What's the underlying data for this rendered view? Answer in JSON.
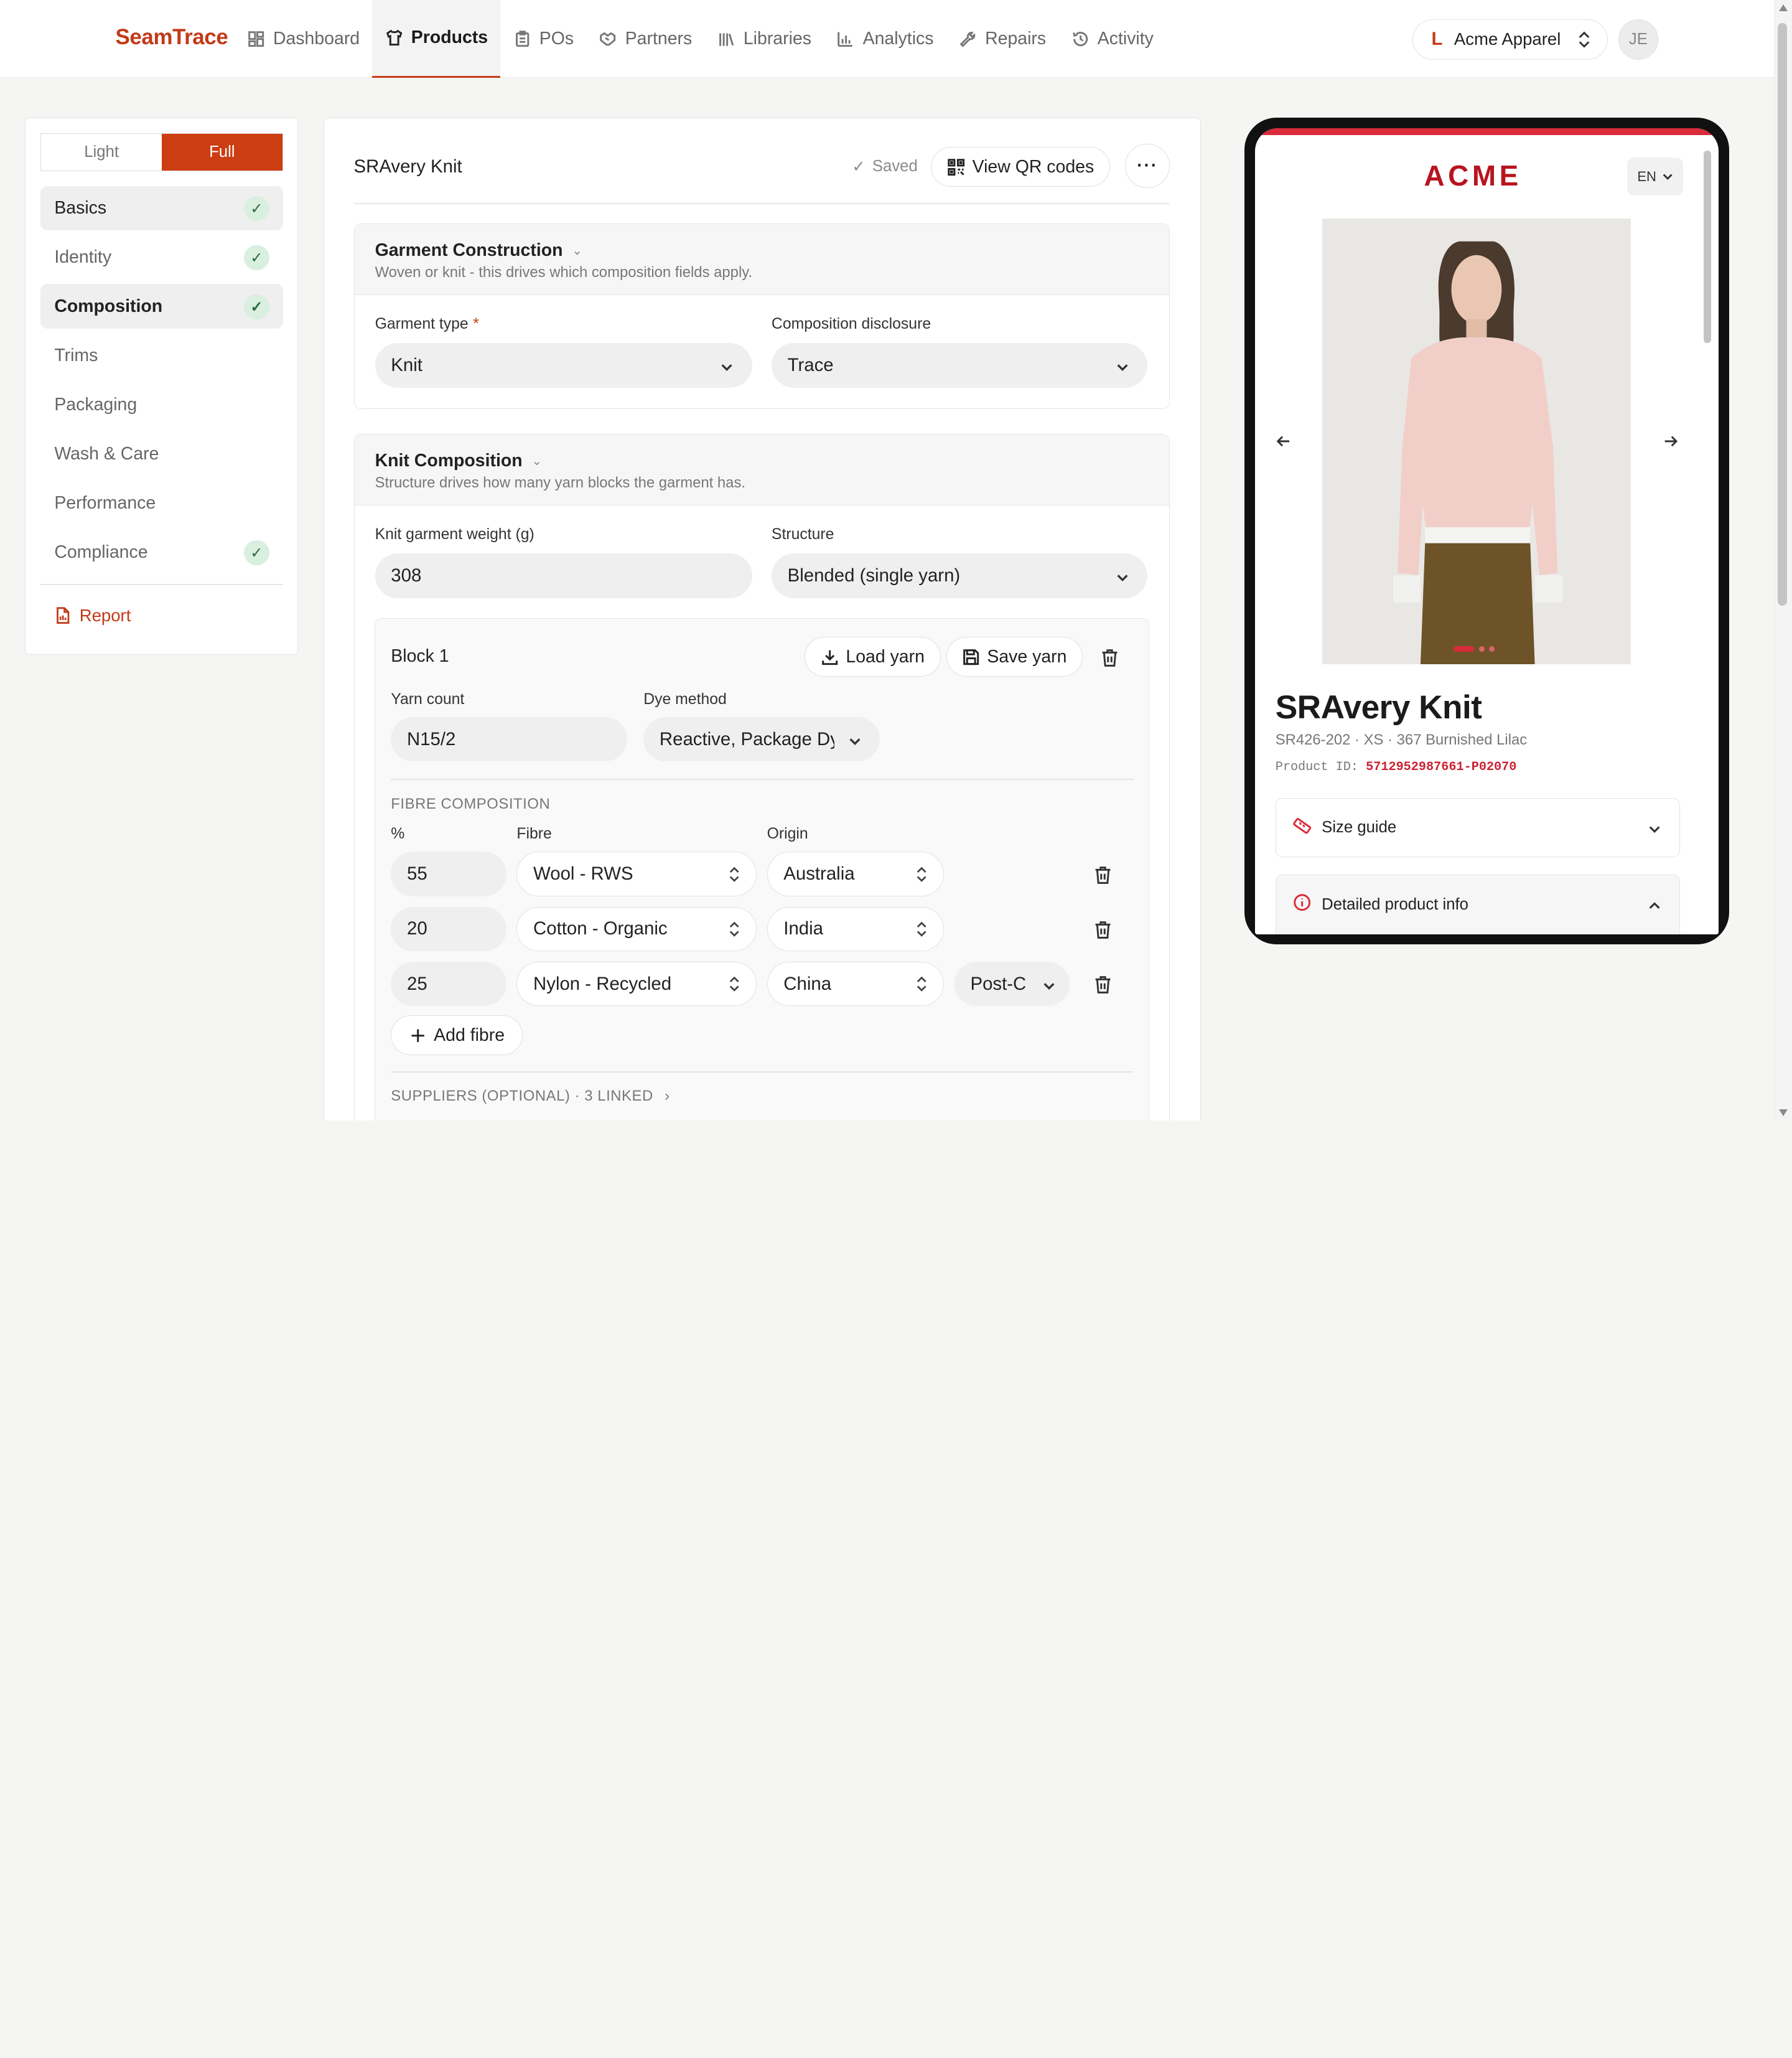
{
  "app": {
    "name": "SeamTrace"
  },
  "nav": {
    "items": [
      {
        "label": "Dashboard",
        "icon": "dashboard-icon"
      },
      {
        "label": "Products",
        "icon": "shirt-icon",
        "active": true
      },
      {
        "label": "POs",
        "icon": "clipboard-icon"
      },
      {
        "label": "Partners",
        "icon": "handshake-icon"
      },
      {
        "label": "Libraries",
        "icon": "library-icon"
      },
      {
        "label": "Analytics",
        "icon": "bar-chart-icon"
      },
      {
        "label": "Repairs",
        "icon": "wrench-icon"
      },
      {
        "label": "Activity",
        "icon": "history-icon"
      }
    ]
  },
  "org": {
    "initial": "L",
    "name": "Acme Apparel"
  },
  "user": {
    "initials": "JE"
  },
  "sidebar": {
    "mode_light": "Light",
    "mode_full": "Full",
    "sections": [
      {
        "label": "Basics",
        "complete": true
      },
      {
        "label": "Identity",
        "complete": true
      },
      {
        "label": "Composition",
        "complete": true,
        "current": true
      },
      {
        "label": "Trims",
        "complete": false
      },
      {
        "label": "Packaging",
        "complete": false
      },
      {
        "label": "Wash & Care",
        "complete": false
      },
      {
        "label": "Performance",
        "complete": false
      },
      {
        "label": "Compliance",
        "complete": true
      }
    ],
    "check_glyph": "✓",
    "report_label": "Report"
  },
  "editor": {
    "product_title": "SRAvery Knit",
    "saved_label": "Saved",
    "view_qr_label": "View QR codes",
    "more_label": "···"
  },
  "garment_construction": {
    "title": "Garment Construction",
    "subtitle": "Woven or knit - this drives which composition fields apply.",
    "garment_type_label": "Garment type",
    "required_mark": "*",
    "garment_type_value": "Knit",
    "disclosure_label": "Composition disclosure",
    "disclosure_value": "Trace"
  },
  "knit_composition": {
    "title": "Knit Composition",
    "subtitle": "Structure drives how many yarn blocks the garment has.",
    "weight_label": "Knit garment weight (g)",
    "weight_value": "308",
    "structure_label": "Structure",
    "structure_value": "Blended (single yarn)"
  },
  "block": {
    "title": "Block 1",
    "load_yarn_label": "Load yarn",
    "save_yarn_label": "Save yarn",
    "yarn_count_label": "Yarn count",
    "yarn_count_value": "N15/2",
    "dye_method_label": "Dye method",
    "dye_method_value": "Reactive, Package Dye",
    "fibre_heading": "FIBRE COMPOSITION",
    "col_percent": "%",
    "col_fibre": "Fibre",
    "col_origin": "Origin",
    "fibres": [
      {
        "percent": "55",
        "fibre": "Wool - RWS",
        "origin": "Australia",
        "extra": ""
      },
      {
        "percent": "20",
        "fibre": "Cotton - Organic",
        "origin": "India",
        "extra": ""
      },
      {
        "percent": "25",
        "fibre": "Nylon - Recycled",
        "origin": "China",
        "extra": "Post-C"
      }
    ],
    "add_fibre_label": "Add fibre",
    "suppliers_label": "SUPPLIERS (OPTIONAL) · 3 LINKED"
  },
  "preview": {
    "brand": "ACME",
    "lang": "EN",
    "product_name": "SRAvery Knit",
    "product_sub": "SR426-202 · XS · 367 Burnished Lilac",
    "product_id_label": "Product ID:",
    "product_id_value": "5712952987661-P02070",
    "size_guide_label": "Size guide",
    "detailed_info_label": "Detailed product info",
    "colors": {
      "accent": "#d92b3a",
      "brand": "#b8141f",
      "sweater": "#f1cfc8",
      "trousers": "#6d5327"
    }
  },
  "colors": {
    "primary": "#cc3d12",
    "success_bg": "#d9efe0"
  }
}
